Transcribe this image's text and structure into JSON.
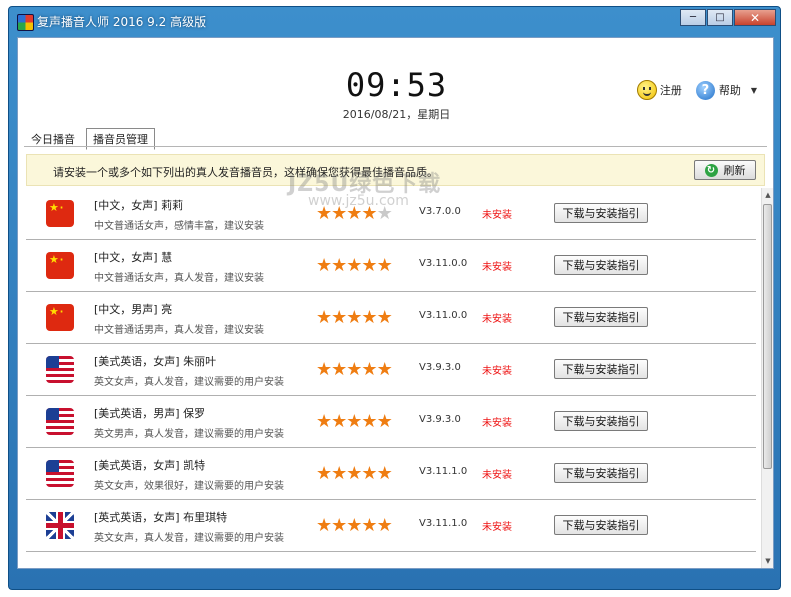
{
  "window": {
    "title": "复声播音人师 2016 9.2 高级版",
    "minimize": "─",
    "maximize": "□",
    "close": "✕"
  },
  "header": {
    "time": "09:53",
    "date": "2016/08/21，星期日",
    "register_label": "注册",
    "help_label": "帮助",
    "menu_caret": "▼"
  },
  "tabs": [
    {
      "label": "今日播音",
      "active": false
    },
    {
      "label": "播音员管理",
      "active": true
    }
  ],
  "notice": {
    "text": "请安装一个或多个如下列出的真人发音播音员，这样确保您获得最佳播音品质。",
    "refresh_label": "刷新",
    "refresh_icon": "↻"
  },
  "voices": [
    {
      "flag": "cn",
      "name": "[中文，女声] 莉莉",
      "desc": "中文普通话女声，感情丰富，建议安装",
      "rating": 4,
      "version": "V3.7.0.0",
      "status": "未安装",
      "button": "下载与安装指引"
    },
    {
      "flag": "cn",
      "name": "[中文，女声] 慧",
      "desc": "中文普通话女声，真人发音，建议安装",
      "rating": 5,
      "version": "V3.11.0.0",
      "status": "未安装",
      "button": "下载与安装指引"
    },
    {
      "flag": "cn",
      "name": "[中文，男声] 亮",
      "desc": "中文普通话男声，真人发音，建议安装",
      "rating": 5,
      "version": "V3.11.0.0",
      "status": "未安装",
      "button": "下载与安装指引"
    },
    {
      "flag": "us",
      "name": "[美式英语，女声] 朱丽叶",
      "desc": "英文女声，真人发音，建议需要的用户安装",
      "rating": 5,
      "version": "V3.9.3.0",
      "status": "未安装",
      "button": "下载与安装指引"
    },
    {
      "flag": "us",
      "name": "[美式英语，男声] 保罗",
      "desc": "英文男声，真人发音，建议需要的用户安装",
      "rating": 5,
      "version": "V3.9.3.0",
      "status": "未安装",
      "button": "下载与安装指引"
    },
    {
      "flag": "us",
      "name": "[美式英语，女声] 凯特",
      "desc": "英文女声，效果很好，建议需要的用户安装",
      "rating": 5,
      "version": "V3.11.1.0",
      "status": "未安装",
      "button": "下载与安装指引"
    },
    {
      "flag": "uk",
      "name": "[英式英语，女声] 布里琪特",
      "desc": "英文女声，真人发音，建议需要的用户安装",
      "rating": 5,
      "version": "V3.11.1.0",
      "status": "未安装",
      "button": "下载与安装指引"
    }
  ],
  "watermark": {
    "text": "JZ5U绿色下载",
    "sub": "www.jz5u.com"
  },
  "colors": {
    "title_bar": "#2a72b2",
    "star_on": "#ef7d12",
    "star_off": "#c9c9c9",
    "status_red": "#e11111",
    "notice_bg": "#fbf7da"
  }
}
